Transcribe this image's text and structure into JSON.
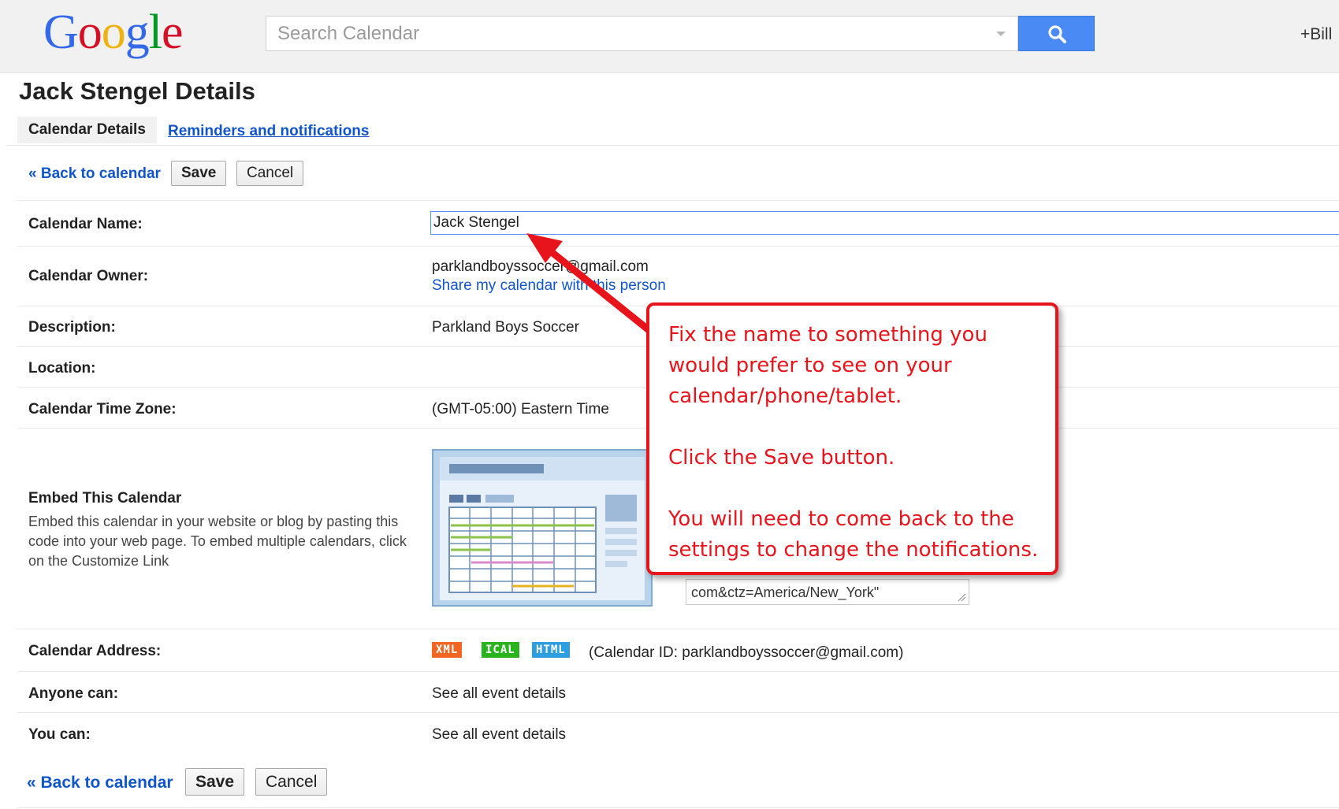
{
  "header": {
    "logo_text": "Google",
    "logo_colors": [
      "#3369e8",
      "#d50f25",
      "#eeb211",
      "#3369e8",
      "#009925",
      "#d50f25"
    ],
    "search_placeholder": "Search Calendar",
    "search_icon": "search-icon",
    "plus_user": "+Bill",
    "accent": "#4a8af4"
  },
  "page": {
    "title": "Jack Stengel Details",
    "tabs": [
      {
        "label": "Calendar Details",
        "active": true
      },
      {
        "label": "Reminders and notifications",
        "active": false
      }
    ],
    "back_link": "« Back to calendar",
    "save_label": "Save",
    "cancel_label": "Cancel"
  },
  "details": {
    "name_label": "Calendar Name:",
    "name_value": "Jack Stengel",
    "owner_label": "Calendar Owner:",
    "owner_email": "parklandboyssoccer@gmail.com",
    "owner_share_link": "Share my calendar with this person",
    "description_label": "Description:",
    "description_value": "Parkland Boys Soccer",
    "location_label": "Location:",
    "location_value": "",
    "timezone_label": "Calendar Time Zone:",
    "timezone_value": "(GMT-05:00) Eastern Time",
    "embed_title": "Embed This Calendar",
    "embed_desc": "Embed this calendar in your website or blog by pasting this code into your web page. To embed multiple calendars, click on the Customize Link",
    "embed_code_visible": "com&ctz=America/New_York\"",
    "address_label": "Calendar Address:",
    "address_badges": [
      {
        "label": "XML",
        "color": "#f26522"
      },
      {
        "label": "ICAL",
        "color": "#29b31f"
      },
      {
        "label": "HTML",
        "color": "#2d9ee0"
      }
    ],
    "calendar_id": "(Calendar ID: parklandboyssoccer@gmail.com)",
    "anyone_label": "Anyone can:",
    "anyone_value": "See all event details",
    "you_label": "You can:",
    "you_value": "See all event details"
  },
  "callout": {
    "color": "#e8141b",
    "lines": [
      "Fix the name to something you",
      "would prefer to see on your",
      "calendar/phone/tablet.",
      "",
      "Click the Save button.",
      "",
      "You will need to come back to the",
      "settings to change the notifications."
    ]
  }
}
